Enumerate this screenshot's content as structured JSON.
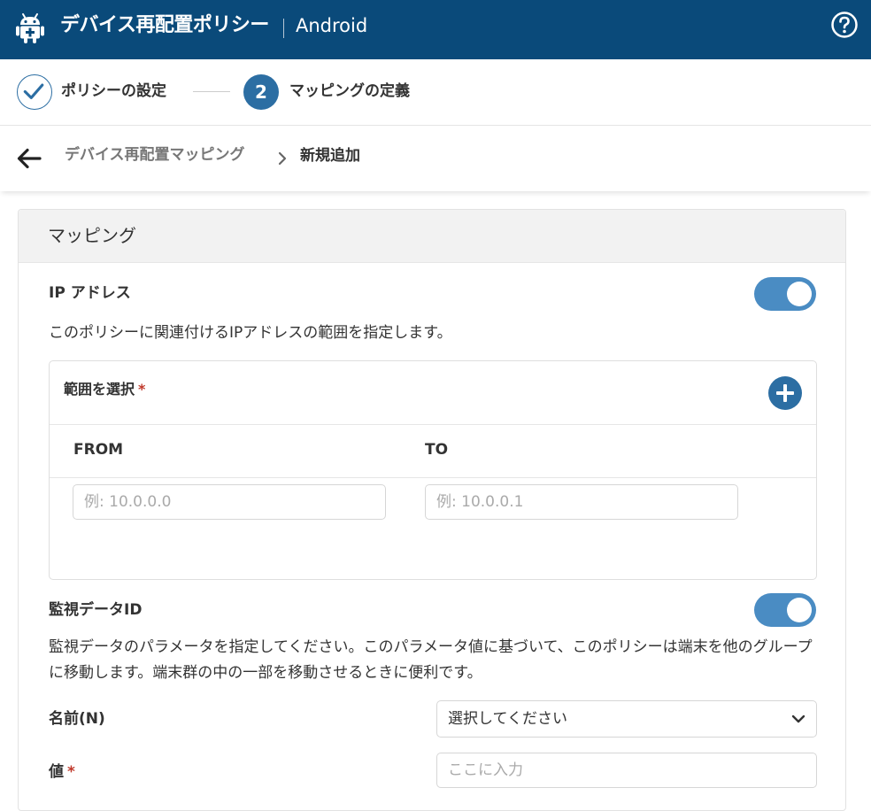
{
  "header": {
    "title": "デバイス再配置ポリシー",
    "platform": "Android"
  },
  "steps": [
    {
      "label": "ポリシーの設定",
      "status": "done"
    },
    {
      "number": "2",
      "label": "マッピングの定義",
      "status": "active"
    }
  ],
  "breadcrumb": {
    "parent": "デバイス再配置マッピング",
    "current": "新規追加"
  },
  "card": {
    "title": "マッピング",
    "ip_section": {
      "label": "IP アドレス",
      "enabled": true,
      "description": "このポリシーに関連付けるIPアドレスの範囲を指定します。",
      "range": {
        "title": "範囲を選択",
        "required_mark": "*",
        "columns": {
          "from": "FROM",
          "to": "TO"
        },
        "from_placeholder": "例: 10.0.0.0",
        "to_placeholder": "例: 10.0.0.1"
      }
    },
    "monitor_section": {
      "label": "監視データID",
      "enabled": true,
      "description": "監視データのパラメータを指定してください。このパラメータ値に基づいて、このポリシーは端末を他のグループに移動します。端末群の中の一部を移動させるときに便利です。",
      "name_label": "名前(N)",
      "name_select_value": "選択してください",
      "value_label": "値",
      "value_required_mark": "*",
      "value_placeholder": "ここに入力"
    }
  },
  "colors": {
    "header_bg": "#0a4a7a",
    "accent": "#2c6ea3",
    "toggle_on": "#4a8cc3",
    "required": "#c0392b"
  }
}
